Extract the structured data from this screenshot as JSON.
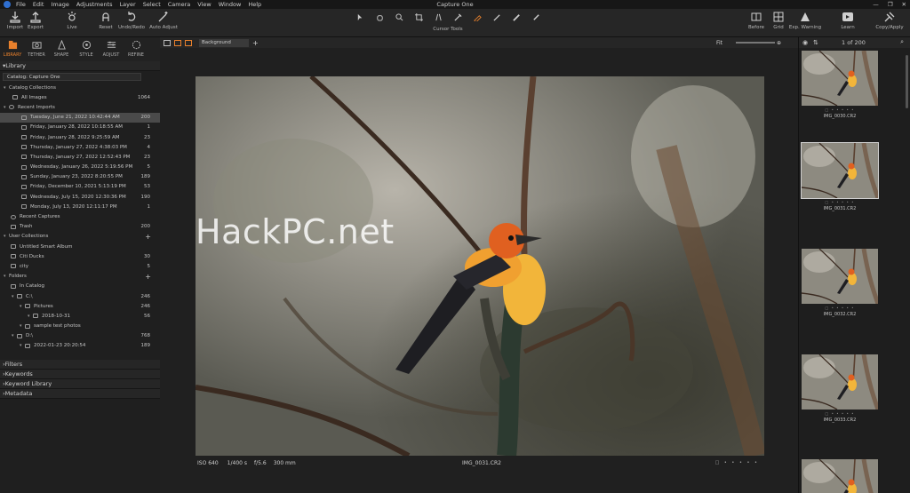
{
  "app": {
    "title": "Capture One"
  },
  "menu": [
    "File",
    "Edit",
    "Image",
    "Adjustments",
    "Layer",
    "Select",
    "Camera",
    "View",
    "Window",
    "Help"
  ],
  "window_buttons": [
    "—",
    "❐",
    "✕"
  ],
  "toolbar": {
    "import": "Import",
    "export": "Export",
    "live": "Live",
    "reset": "Reset",
    "undo_redo": "Undo/Redo",
    "auto_adjust": "Auto Adjust",
    "cursor_tools": "Cursor Tools",
    "before": "Before",
    "grid": "Grid",
    "exp_warning": "Exp. Warning",
    "learn": "Learn",
    "copy_apply": "Copy/Apply"
  },
  "tool_tabs": [
    "LIBRARY",
    "TETHER",
    "SHAPE",
    "STYLE",
    "ADJUST",
    "REFINE"
  ],
  "library": {
    "title": "Library",
    "catalog": "Catalog: Capture One",
    "catalog_collections": "Catalog Collections",
    "all_images": {
      "label": "All Images",
      "count": "1064"
    },
    "recent_imports": "Recent Imports",
    "imports": [
      {
        "label": "Tuesday, June 21, 2022 10:42:44 AM",
        "count": "200"
      },
      {
        "label": "Friday, January 28, 2022 10:18:55 AM",
        "count": "1"
      },
      {
        "label": "Friday, January 28, 2022 9:25:59 AM",
        "count": "23"
      },
      {
        "label": "Thursday, January 27, 2022 4:38:03 PM",
        "count": "4"
      },
      {
        "label": "Thursday, January 27, 2022 12:52:43 PM",
        "count": "23"
      },
      {
        "label": "Wednesday, January 26, 2022 5:19:56 PM",
        "count": "5"
      },
      {
        "label": "Sunday, January 23, 2022 8:20:55 PM",
        "count": "189"
      },
      {
        "label": "Friday, December 10, 2021 5:13:19 PM",
        "count": "53"
      },
      {
        "label": "Wednesday, July 15, 2020 12:30:36 PM",
        "count": "190"
      },
      {
        "label": "Monday, July 13, 2020 12:11:17 PM",
        "count": "1"
      }
    ],
    "recent_captures": "Recent Captures",
    "trash": {
      "label": "Trash",
      "count": "200"
    },
    "user_collections": "User Collections",
    "user_items": [
      {
        "label": "Untitled Smart Album",
        "count": ""
      },
      {
        "label": "Citi Ducks",
        "count": "30"
      },
      {
        "label": "city",
        "count": "5"
      }
    ],
    "folders": "Folders",
    "in_catalog": "In Catalog",
    "folder_items": [
      {
        "label": "C:\\",
        "count": "246",
        "indent": 1
      },
      {
        "label": "Pictures",
        "count": "246",
        "indent": 2
      },
      {
        "label": "2018-10-31",
        "count": "56",
        "indent": 3
      },
      {
        "label": "sample test photos",
        "count": "",
        "indent": 2
      },
      {
        "label": "D:\\",
        "count": "768",
        "indent": 1
      },
      {
        "label": "2022-01-23 20:20:54",
        "count": "189",
        "indent": 2
      }
    ],
    "filters": "Filters",
    "keywords": "Keywords",
    "keyword_library": "Keyword Library",
    "metadata": "Metadata"
  },
  "viewer": {
    "style_select": "Background",
    "fit": "Fit",
    "counter": "1 of 200",
    "info": {
      "iso": "ISO 640",
      "shutter": "1/400 s",
      "aperture": "f/5.6",
      "focal": "300 mm",
      "filename": "IMG_0031.CR2"
    }
  },
  "watermark": "HackPC.net",
  "thumbnails": [
    {
      "label": "IMG_0030.CR2",
      "selected": false
    },
    {
      "label": "IMG_0031.CR2",
      "selected": true
    },
    {
      "label": "IMG_0032.CR2",
      "selected": false
    },
    {
      "label": "IMG_0033.CR2",
      "selected": false
    },
    {
      "label": "",
      "selected": false
    }
  ],
  "colors": {
    "accent": "#e8802c",
    "panel": "#1f1f1f",
    "selected_row": "#4a4a4a"
  }
}
